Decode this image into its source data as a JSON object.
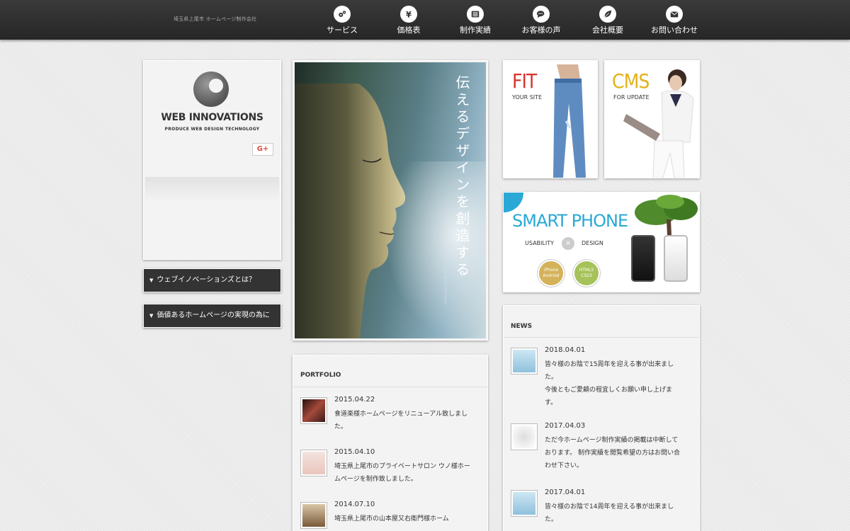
{
  "header": {
    "tagline": "埼玉県上尾市 ホームページ制作会社",
    "nav": [
      {
        "label": "サービス",
        "icon": "gears-icon"
      },
      {
        "label": "価格表",
        "icon": "yen-icon"
      },
      {
        "label": "制作実績",
        "icon": "list-icon"
      },
      {
        "label": "お客様の声",
        "icon": "comments-icon"
      },
      {
        "label": "会社概要",
        "icon": "leaf-icon"
      },
      {
        "label": "お問い合わせ",
        "icon": "envelope-icon"
      }
    ]
  },
  "logo": {
    "title": "WEB INNOVATIONS",
    "subtitle": "PRODUCE WEB DESIGN TECHNOLOGY",
    "gplus": "G+"
  },
  "sidebar": {
    "links": [
      {
        "label": "ウェブイノベーションズとは？"
      },
      {
        "label": "価値あるホームページの実現の為に"
      }
    ],
    "arrow": "▼"
  },
  "hero": {
    "headline": "伝えるデザインを創造する",
    "small_text": "WEB INNOVATIONS"
  },
  "banners": {
    "fit": {
      "title": "FIT",
      "sub": "YOUR SITE"
    },
    "cms": {
      "title": "CMS",
      "sub": "FOR UPDATE"
    },
    "smart": {
      "title": "SMART PHONE",
      "usability": "USABILITY",
      "design": "DESIGN",
      "x": "×",
      "badge1": "iPhone Android",
      "badge2": "HTML5 CSS3"
    }
  },
  "portfolio": {
    "title": "PORTFOLIO",
    "items": [
      {
        "date": "2015.04.22",
        "text": "食道楽様ホームページをリニューアル致しました。"
      },
      {
        "date": "2015.04.10",
        "text": "埼玉県上尾市のプライベートサロン ウノ様ホームページを制作致しました。"
      },
      {
        "date": "2014.07.10",
        "text": "埼玉県上尾市の山本屋又右衛門様ホーム"
      }
    ]
  },
  "news": {
    "title": "NEWS",
    "items": [
      {
        "date": "2018.04.01",
        "text": "皆々様のお陰で15周年を迎える事が出来ました。\n今後ともご愛顧の程宜しくお願い申し上げます。"
      },
      {
        "date": "2017.04.03",
        "text": "ただ今ホームページ制作実績の掲載は中断しております。 制作実績を閲覧希望の方はお問い合わせ下さい。"
      },
      {
        "date": "2017.04.01",
        "text": "皆々様のお陰で14周年を迎える事が出来ました。"
      }
    ]
  },
  "colors": {
    "header_bg": "#2b2b2b",
    "accent_blue": "#2aa9d6",
    "fit_red": "#d8322a",
    "cms_yellow": "#e2b21a",
    "badge_gold": "#d4b25a",
    "badge_green": "#a6c25a"
  }
}
